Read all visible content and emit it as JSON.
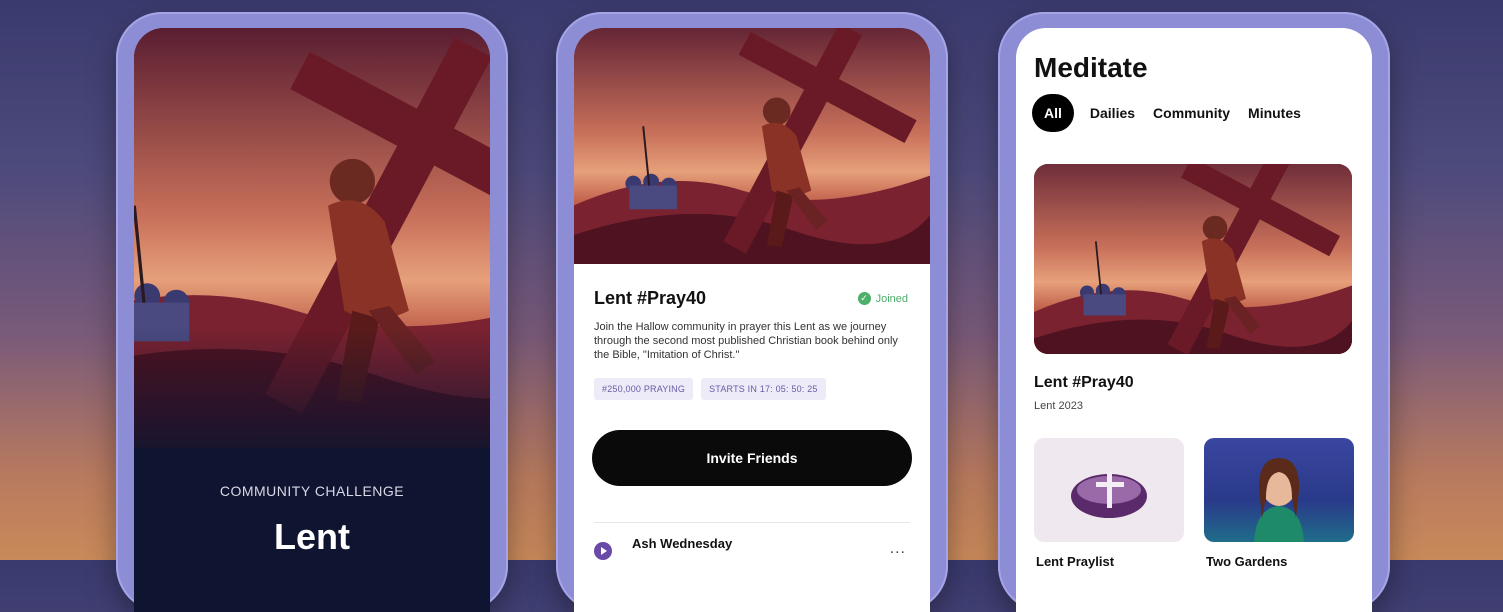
{
  "phone1": {
    "kicker": "COMMUNITY CHALLENGE",
    "title": "Lent"
  },
  "phone2": {
    "title": "Lent #Pray40",
    "joined": "Joined",
    "description": "Join the Hallow community in prayer this Lent as we journey through the second most published Christian book behind only the Bible, \"Imitation of Christ.\"",
    "chips": [
      "#250,000 PRAYING",
      "STARTS IN 17: 05: 50: 25"
    ],
    "invite_label": "Invite Friends",
    "list_item_title": "Ash Wednesday",
    "more": "..."
  },
  "phone3": {
    "heading": "Meditate",
    "tabs": [
      "All",
      "Dailies",
      "Community",
      "Minutes"
    ],
    "card_title": "Lent #Pray40",
    "card_subtitle": "Lent 2023",
    "tiles": [
      "Lent Praylist",
      "Two Gardens"
    ]
  },
  "colors": {
    "accent_purple": "#6a4aa8",
    "joined_green": "#4caf6a",
    "phone_frame": "#8d8dd6"
  }
}
